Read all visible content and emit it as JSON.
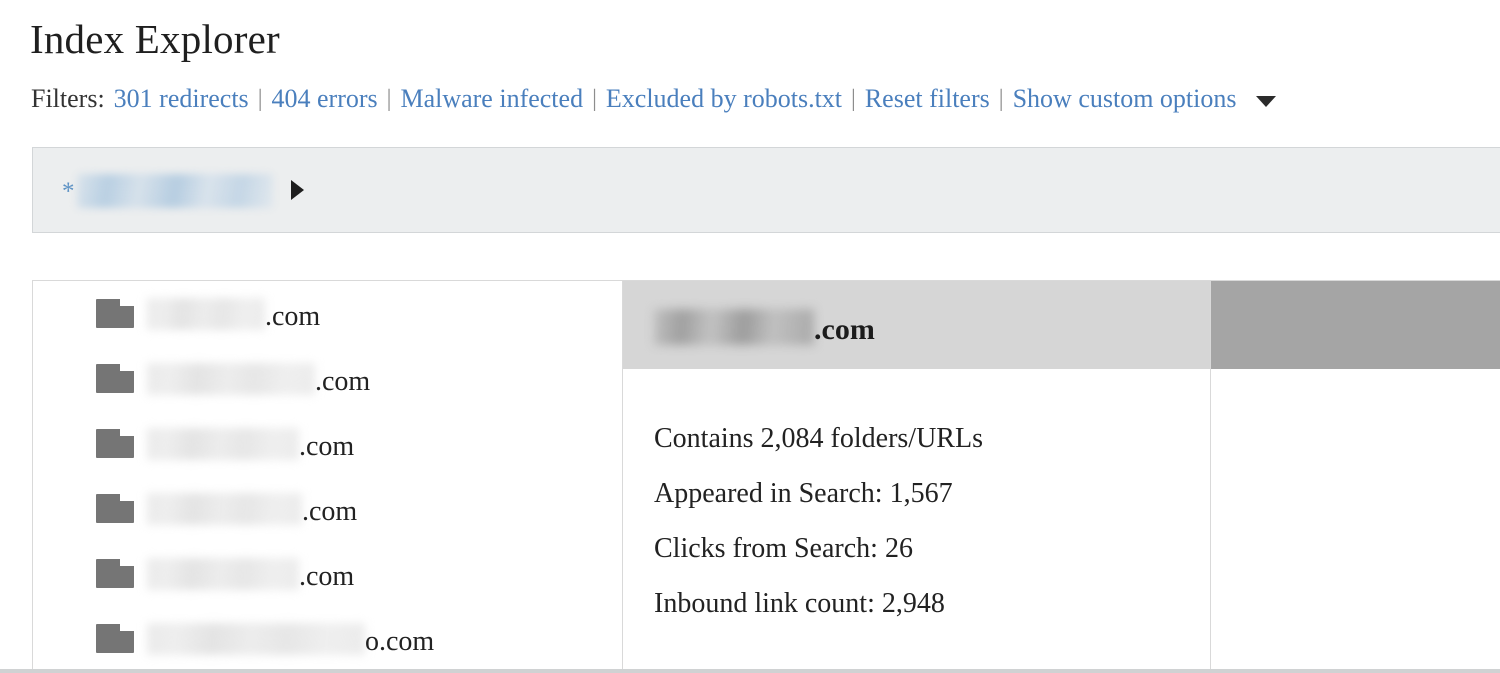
{
  "header": {
    "title": "Index Explorer",
    "filters_label": "Filters:",
    "separator": "|",
    "filters": [
      {
        "label": "301 redirects"
      },
      {
        "label": "404 errors"
      },
      {
        "label": "Malware infected"
      },
      {
        "label": "Excluded by robots.txt"
      },
      {
        "label": "Reset filters"
      },
      {
        "label": "Show custom options"
      }
    ],
    "caret_icon": "chevron-down-icon",
    "link_color": "#4a7fbd"
  },
  "breadcrumb": {
    "star": "*",
    "root_label": "",
    "root_redacted": true,
    "arrow_icon": "caret-right-icon",
    "background": "#eceeef"
  },
  "explorer": {
    "folder_list": {
      "icon": "folder-icon",
      "items": [
        {
          "name_redacted": true,
          "redact_width": 118,
          "tld": ".com"
        },
        {
          "name_redacted": true,
          "redact_width": 168,
          "tld": ".com"
        },
        {
          "name_redacted": true,
          "redact_width": 152,
          "tld": ".com"
        },
        {
          "name_redacted": true,
          "redact_width": 155,
          "tld": ".com"
        },
        {
          "name_redacted": true,
          "redact_width": 152,
          "tld": ".com"
        },
        {
          "name_redacted": true,
          "redact_width": 218,
          "tld": "o.com"
        }
      ]
    },
    "detail": {
      "title_redacted": true,
      "title_tld": ".com",
      "header_background": "#d6d6d6",
      "stats": [
        {
          "text": "Contains 2,084 folders/URLs",
          "label": "Contains",
          "value": "2,084",
          "unit": "folders/URLs"
        },
        {
          "text": "Appeared in Search: 1,567",
          "label": "Appeared in Search",
          "value": "1,567"
        },
        {
          "text": "Clicks from Search: 26",
          "label": "Clicks from Search",
          "value": "26"
        },
        {
          "text": "Inbound link count: 2,948",
          "label": "Inbound link count",
          "value": "2,948"
        }
      ]
    },
    "third_column": {
      "header_background": "#a5a5a5",
      "body_empty": true
    }
  }
}
